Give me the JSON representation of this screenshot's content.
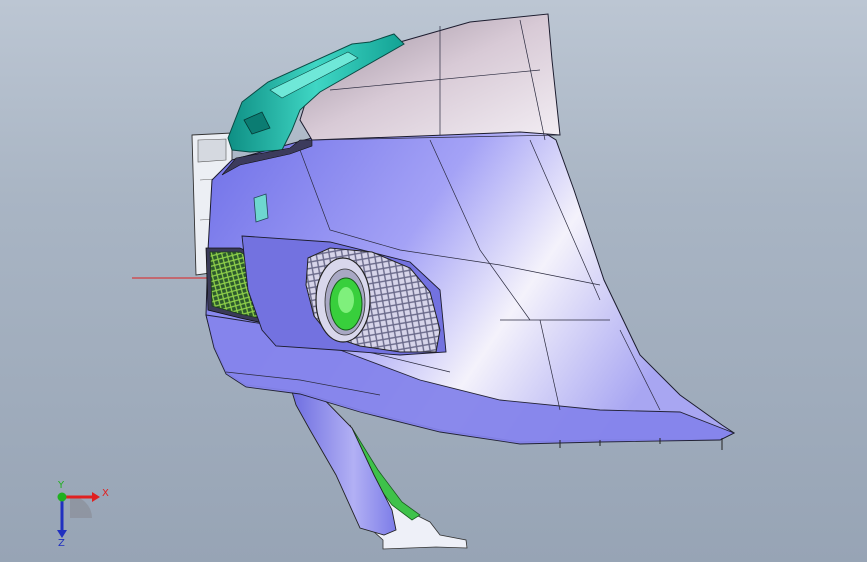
{
  "viewport": {
    "background_top": "#bcc6d3",
    "background_bottom": "#97a4b5"
  },
  "model": {
    "body_color": "#8f8ef3",
    "upper_color": "#cdbfd0",
    "bracket_color": "#1fb8a8",
    "grille_color": "#7fbf3a",
    "foglamp_color": "#4ad84a"
  },
  "triad": {
    "x_label": "X",
    "y_label": "Y",
    "z_label": "Z",
    "x_color": "#e02020",
    "y_color": "#20b020",
    "z_color": "#2030c0"
  }
}
